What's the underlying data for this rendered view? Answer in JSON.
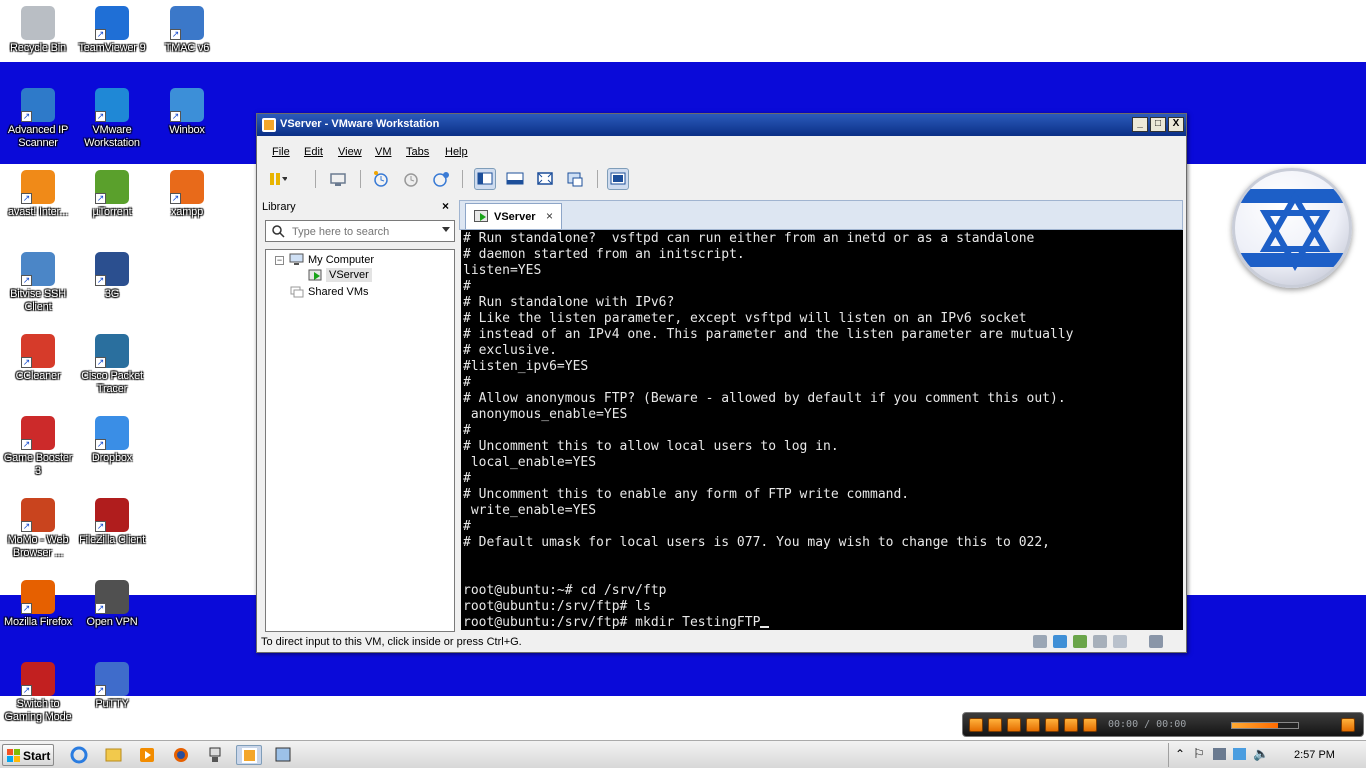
{
  "desktop": {
    "icons": [
      {
        "label": "Recycle Bin",
        "icon": "recycle-bin-icon"
      },
      {
        "label": "TeamViewer 9",
        "icon": "teamviewer-icon"
      },
      {
        "label": "TMAC v6",
        "icon": "tmac-icon"
      },
      {
        "label": "Advanced IP Scanner",
        "icon": "ip-scanner-icon"
      },
      {
        "label": "VMware Workstation",
        "icon": "vmware-icon"
      },
      {
        "label": "Winbox",
        "icon": "winbox-icon"
      },
      {
        "label": "avast! Inter...",
        "icon": "avast-icon"
      },
      {
        "label": "µTorrent",
        "icon": "utorrent-icon"
      },
      {
        "label": "xampp",
        "icon": "xampp-icon"
      },
      {
        "label": "Bitvise SSH Client",
        "icon": "bitvise-icon"
      },
      {
        "label": "3G",
        "icon": "modem-icon"
      },
      {
        "label": "CCleaner",
        "icon": "ccleaner-icon"
      },
      {
        "label": "Cisco Packet Tracer",
        "icon": "packet-tracer-icon"
      },
      {
        "label": "Game Booster 3",
        "icon": "game-booster-icon"
      },
      {
        "label": "Dropbox",
        "icon": "dropbox-icon"
      },
      {
        "label": "MoMo - Web Browser ...",
        "icon": "momo-browser-icon"
      },
      {
        "label": "FileZilla Client",
        "icon": "filezilla-icon"
      },
      {
        "label": "Mozilla Firefox",
        "icon": "firefox-icon"
      },
      {
        "label": "Open VPN",
        "icon": "openvpn-icon"
      },
      {
        "label": "Switch to Gaming Mode",
        "icon": "gaming-mode-icon"
      },
      {
        "label": "PuTTY",
        "icon": "putty-icon"
      }
    ]
  },
  "window": {
    "title": "VServer - VMware Workstation",
    "controls": {
      "minimize": "_",
      "maximize": "□",
      "close": "X"
    },
    "menu": [
      "File",
      "Edit",
      "View",
      "VM",
      "Tabs",
      "Help"
    ],
    "library": {
      "heading": "Library",
      "close": "×",
      "search_placeholder": "Type here to search",
      "tree": {
        "root": "My Computer",
        "vm": "VServer",
        "shared": "Shared VMs",
        "expander": "−"
      }
    },
    "tab": {
      "label": "VServer",
      "close": "×"
    },
    "console_lines": [
      "# Run standalone?  vsftpd can run either from an inetd or as a standalone",
      "# daemon started from an initscript.",
      "listen=YES",
      "#",
      "# Run standalone with IPv6?",
      "# Like the listen parameter, except vsftpd will listen on an IPv6 socket",
      "# instead of an IPv4 one. This parameter and the listen parameter are mutually",
      "# exclusive.",
      "#listen_ipv6=YES",
      "#",
      "# Allow anonymous FTP? (Beware - allowed by default if you comment this out).",
      " anonymous_enable=YES",
      "#",
      "# Uncomment this to allow local users to log in.",
      " local_enable=YES",
      "#",
      "# Uncomment this to enable any form of FTP write command.",
      " write_enable=YES",
      "#",
      "# Default umask for local users is 077. You may wish to change this to 022,",
      "",
      "",
      "root@ubuntu:~# cd /srv/ftp",
      "root@ubuntu:/srv/ftp# ls",
      "root@ubuntu:/srv/ftp# mkdir TestingFTP"
    ],
    "status_message": "To direct input to this VM, click inside or press Ctrl+G."
  },
  "player": {
    "time": "00:00 / 00:00",
    "volume_fraction": 0.7
  },
  "taskbar": {
    "start_label": "Start",
    "clock": "2:57 PM"
  },
  "colors": {
    "flag_blue": "#0a0ad9",
    "title_blue": "#0b2f86",
    "console_bg": "#000000",
    "accent_orange": "#f28c00"
  }
}
